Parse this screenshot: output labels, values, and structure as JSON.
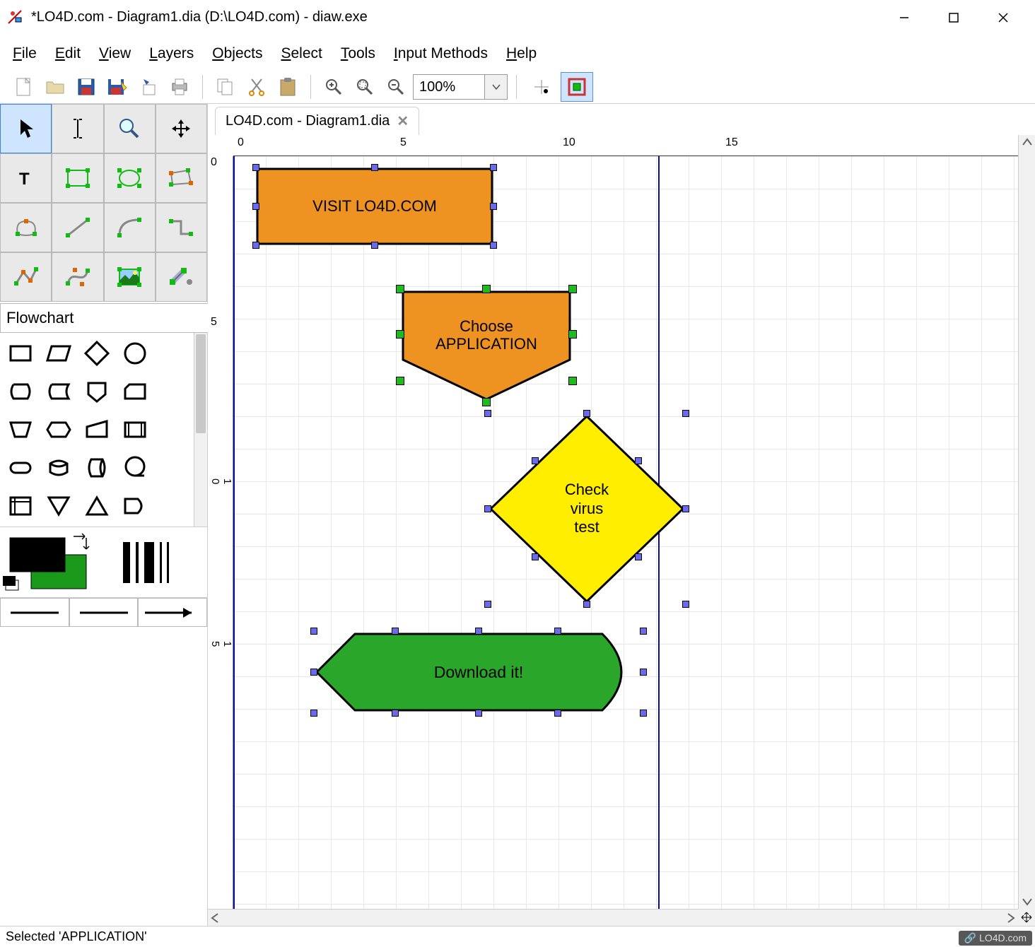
{
  "window": {
    "title": "*LO4D.com - Diagram1.dia (D:\\LO4D.com) - diaw.exe"
  },
  "menu": {
    "file": "File",
    "edit": "Edit",
    "view": "View",
    "layers": "Layers",
    "objects": "Objects",
    "select": "Select",
    "tools": "Tools",
    "input_methods": "Input Methods",
    "help": "Help"
  },
  "toolbar": {
    "zoom_value": "100%"
  },
  "sheet": {
    "name": "Flowchart"
  },
  "tab": {
    "label": "LO4D.com - Diagram1.dia"
  },
  "ruler": {
    "h": [
      "0",
      "5",
      "10",
      "15"
    ],
    "v": [
      "0",
      "5",
      "10",
      "15"
    ]
  },
  "shapes": {
    "box1": "VISIT LO4D.COM",
    "offpage_line1": "Choose",
    "offpage_line2": "APPLICATION",
    "diamond_line1": "Check",
    "diamond_line2": "virus",
    "diamond_line3": "test",
    "arrow": "Download it!"
  },
  "colors": {
    "orange": "#ee9322",
    "yellow": "#ffee00",
    "green": "#2aa62a",
    "fg": "#000000",
    "bg_swatch": "#1a991a"
  },
  "status": {
    "text": "Selected 'APPLICATION'"
  },
  "watermark": "LO4D.com"
}
